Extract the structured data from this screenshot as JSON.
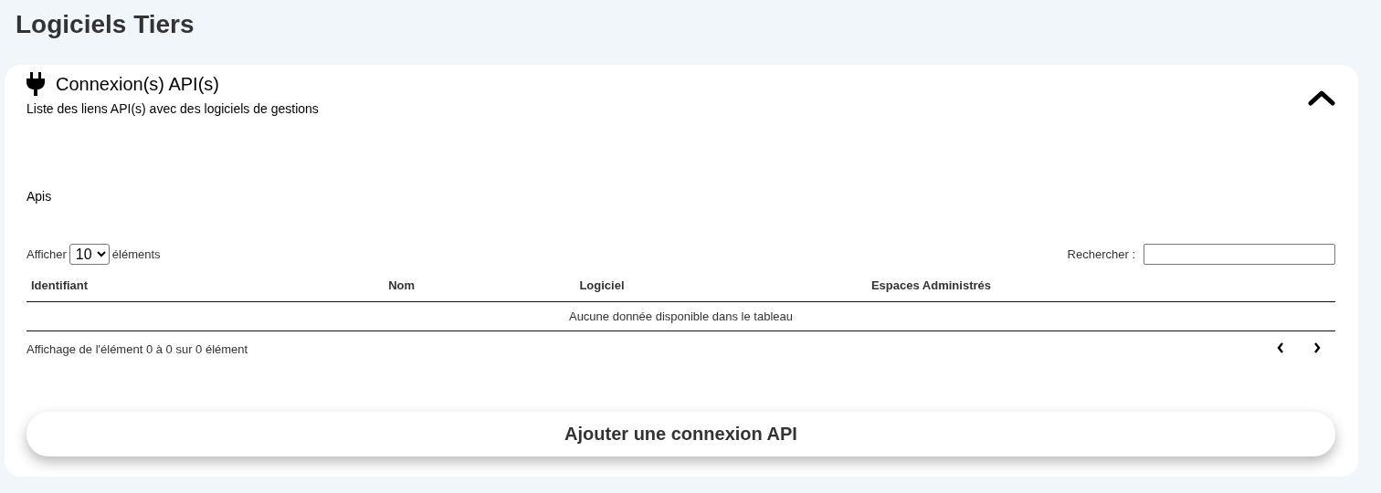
{
  "page": {
    "title": "Logiciels Tiers"
  },
  "card": {
    "title": "Connexion(s) API(s)",
    "subtitle": "Liste des liens API(s) avec des logiciels de gestions",
    "expanded": true
  },
  "section": {
    "title": "Apis"
  },
  "length_control": {
    "label_before": "Afficher",
    "value": "10",
    "label_after": "éléments"
  },
  "search": {
    "label": "Rechercher :"
  },
  "table": {
    "columns": [
      "Identifiant",
      "Nom",
      "Logiciel",
      "Espaces Administrés"
    ],
    "empty_message": "Aucune donnée disponible dans le tableau"
  },
  "info": "Affichage de l'élément 0 à 0 sur 0 élément",
  "add_button": "Ajouter une connexion API"
}
